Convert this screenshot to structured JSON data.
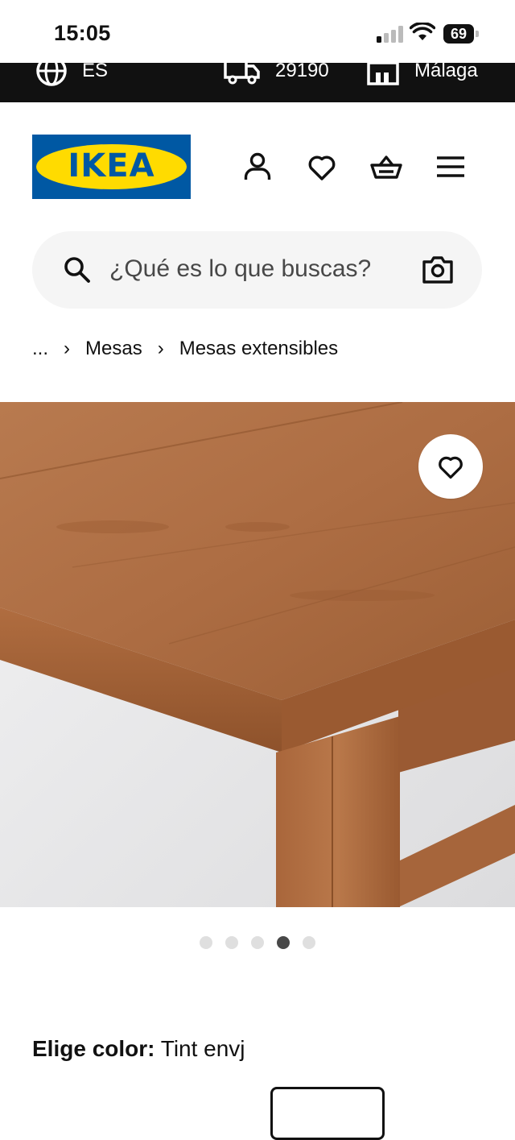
{
  "status_bar": {
    "time": "15:05",
    "battery": "69"
  },
  "top_band": {
    "language": "ES",
    "postcode": "29190",
    "store": "Málaga"
  },
  "header": {
    "logo_text": "IKEA",
    "icons": [
      "account-icon",
      "heart-icon",
      "cart-icon",
      "menu-icon"
    ]
  },
  "search": {
    "placeholder": "¿Qué es lo que buscas?"
  },
  "breadcrumb": {
    "ellipsis": "...",
    "items": [
      "Mesas",
      "Mesas extensibles"
    ]
  },
  "gallery": {
    "total_images": 5,
    "active_index": 3
  },
  "color": {
    "label": "Elige color:",
    "value": "Tint envj"
  },
  "colors": {
    "ikea_blue": "#0058a3",
    "ikea_yellow": "#ffdb00",
    "wood": "#a8693f"
  }
}
